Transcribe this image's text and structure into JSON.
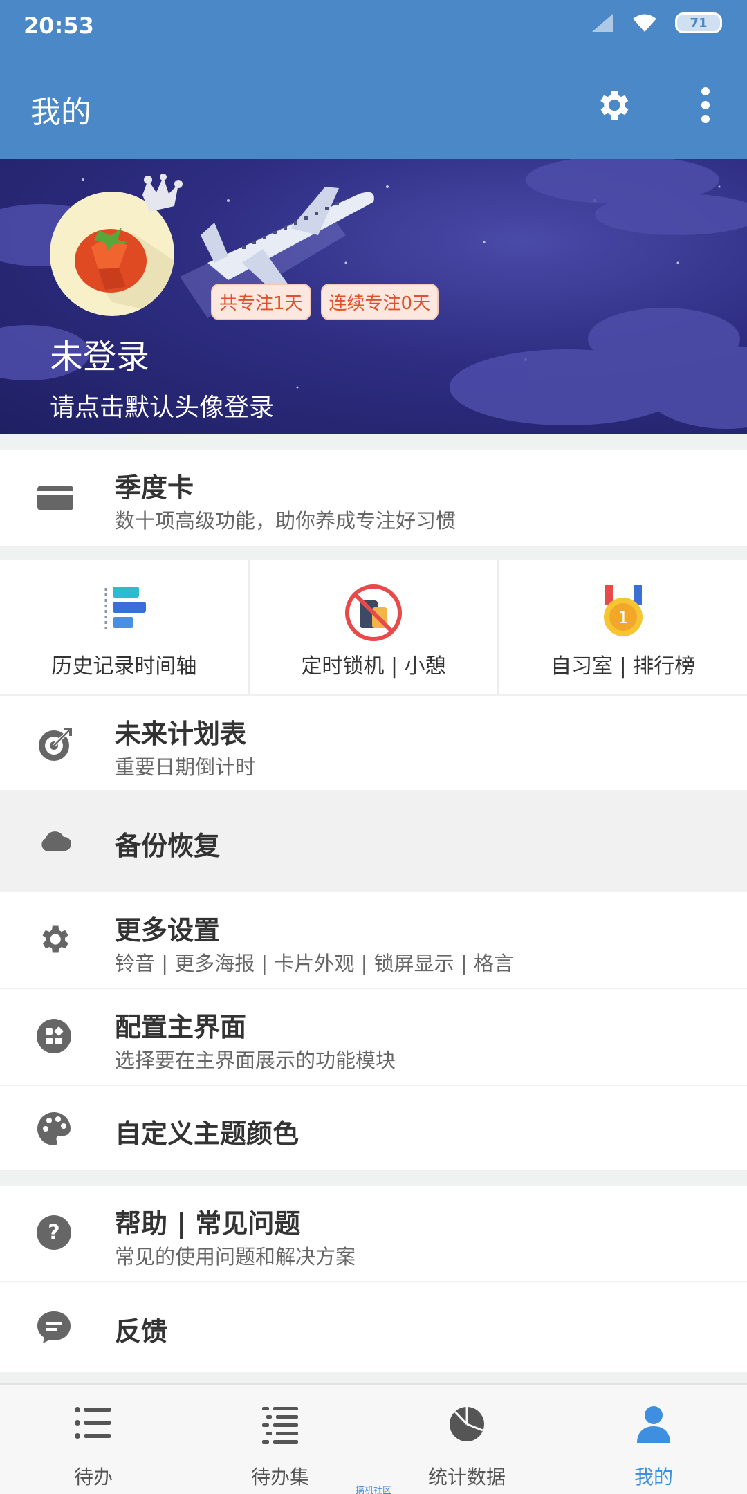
{
  "status": {
    "time": "20:53",
    "battery": "71"
  },
  "header": {
    "title": "我的",
    "settings_icon": "gear-icon",
    "more_icon": "more-vert-icon"
  },
  "profile": {
    "badges": [
      "共专注1天",
      "连续专注0天"
    ],
    "name": "未登录",
    "hint": "请点击默认头像登录"
  },
  "card": {
    "title": "季度卡",
    "subtitle": "数十项高级功能，助你养成专注好习惯",
    "icon": "card-icon"
  },
  "grid": [
    {
      "label": "历史记录时间轴",
      "icon": "timeline-icon"
    },
    {
      "label": "定时锁机 | 小憩",
      "icon": "phone-lock-icon"
    },
    {
      "label": "自习室 | 排行榜",
      "icon": "medal-icon"
    }
  ],
  "menu": {
    "plan": {
      "title": "未来计划表",
      "subtitle": "重要日期倒计时"
    },
    "backup": {
      "title": "备份恢复"
    },
    "settings": {
      "title": "更多设置",
      "subtitle": "铃音 | 更多海报 | 卡片外观 | 锁屏显示 | 格言"
    },
    "layout": {
      "title": "配置主界面",
      "subtitle": "选择要在主界面展示的功能模块"
    },
    "theme": {
      "title": "自定义主题颜色"
    },
    "help": {
      "title": "帮助 | 常见问题",
      "subtitle": "常见的使用问题和解决方案"
    },
    "feedback": {
      "title": "反馈"
    }
  },
  "nav": [
    {
      "label": "待办",
      "icon": "list-icon"
    },
    {
      "label": "待办集",
      "icon": "list-group-icon"
    },
    {
      "label": "统计数据",
      "icon": "pie-chart-icon"
    },
    {
      "label": "我的",
      "icon": "person-icon",
      "active": true
    }
  ],
  "watermark": "搞机社区",
  "colors": {
    "primary": "#4a88c7",
    "accent": "#3f8fe0",
    "badge_text": "#e0502a"
  }
}
